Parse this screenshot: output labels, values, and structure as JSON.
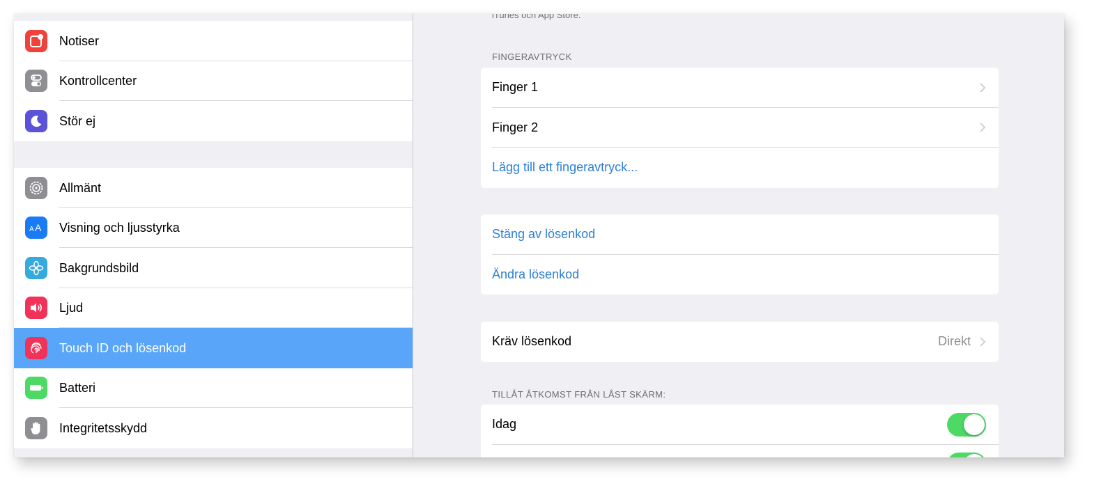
{
  "sidebar": {
    "group1": [
      {
        "label": "Notiser",
        "icon": "notifications-icon",
        "color": "#f2413b"
      },
      {
        "label": "Kontrollcenter",
        "icon": "control-center-icon",
        "color": "#8e8e93"
      },
      {
        "label": "Stör ej",
        "icon": "moon-icon",
        "color": "#5a52d9"
      }
    ],
    "group2": [
      {
        "label": "Allmänt",
        "icon": "gear-icon",
        "color": "#8e8e93"
      },
      {
        "label": "Visning och ljusstyrka",
        "icon": "display-brightness-icon",
        "color": "#1a7cf5"
      },
      {
        "label": "Bakgrundsbild",
        "icon": "wallpaper-icon",
        "color": "#35aadc"
      },
      {
        "label": "Ljud",
        "icon": "speaker-icon",
        "color": "#f1335a"
      },
      {
        "label": "Touch ID och lösenkod",
        "icon": "fingerprint-icon",
        "color": "#f1335a",
        "selected": true
      },
      {
        "label": "Batteri",
        "icon": "battery-icon",
        "color": "#4cd964"
      },
      {
        "label": "Integritetsskydd",
        "icon": "hand-icon",
        "color": "#8e8e93"
      }
    ]
  },
  "detail": {
    "top_text": "iTunes och App Store.",
    "fingerprints": {
      "header": "FINGERAVTRYCK",
      "finger1": "Finger 1",
      "finger2": "Finger 2",
      "add": "Lägg till ett fingeravtryck..."
    },
    "passcode": {
      "turn_off": "Stäng av lösenkod",
      "change": "Ändra lösenkod"
    },
    "require": {
      "label": "Kräv lösenkod",
      "value": "Direkt"
    },
    "lock_screen": {
      "header": "TILLÅT ÅTKOMST FRÅN LÅST SKÄRM:",
      "today": "Idag",
      "today_on": true
    }
  },
  "colors": {
    "accent": "#2c7fd6",
    "selected_row": "#58a5f9",
    "toggle_on": "#4cd964"
  }
}
